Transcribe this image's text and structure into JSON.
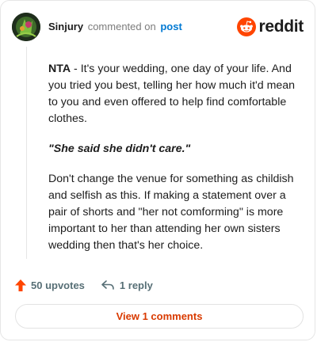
{
  "comment": {
    "username": "Sinjury",
    "commented_on": "commented on",
    "post_link": "post",
    "paragraphs": [
      {
        "bold": "NTA",
        "text": " - It's your wedding, one day of your life. And you tried you best, telling her how much it'd mean to you and even offered to help find comfortable clothes."
      },
      {
        "quote": "\"She said she didn't care.\""
      },
      {
        "text": "Don't change the venue for something as childish and selfish as this. If making a statement over a pair of shorts and \"her not comforming\" is more important to her than attending her own sisters wedding then that's her choice."
      }
    ]
  },
  "brand": {
    "wordmark": "reddit",
    "color": "#ff4500"
  },
  "actions": {
    "upvotes_label": "50 upvotes",
    "reply_label": "1 reply",
    "upvote_color": "#ff4500"
  },
  "view_comments_label": "View 1 comments",
  "icons": [
    "avatar",
    "reddit-logo-icon",
    "upvote-arrow-icon",
    "reply-arrow-icon"
  ]
}
